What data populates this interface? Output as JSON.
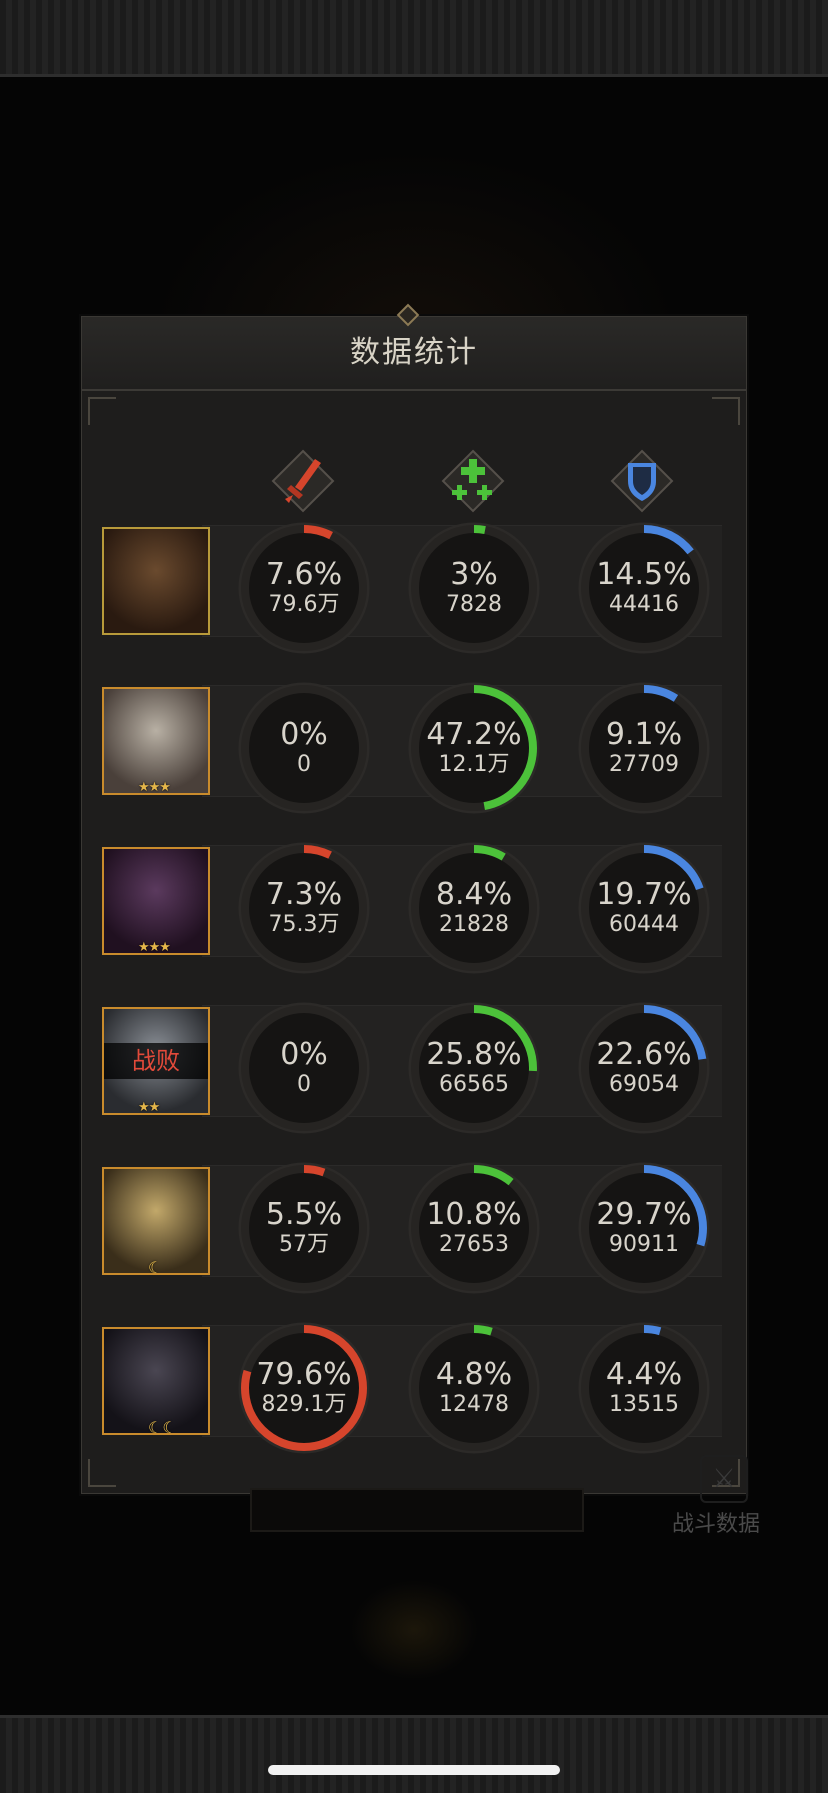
{
  "title": "数据统计",
  "background": {
    "corner_link_label": "战斗数据"
  },
  "columns": [
    {
      "name": "damage",
      "icon": "sword-icon",
      "color": "#d6452c"
    },
    {
      "name": "heal",
      "icon": "heal-cross-icon",
      "color": "#4cc23a"
    },
    {
      "name": "tank",
      "icon": "shield-icon",
      "color": "#4a86e0"
    }
  ],
  "heroes": [
    {
      "portrait": "bearded-warrior-portrait",
      "stars": "",
      "moons": "",
      "defeated": "",
      "stats": [
        {
          "pct": "7.6%",
          "value": "79.6万",
          "fraction": 0.076
        },
        {
          "pct": "3%",
          "value": "7828",
          "fraction": 0.03
        },
        {
          "pct": "14.5%",
          "value": "44416",
          "fraction": 0.145
        }
      ]
    },
    {
      "portrait": "silver-priestess-portrait",
      "stars": "★★★",
      "moons": "",
      "defeated": "",
      "stats": [
        {
          "pct": "0%",
          "value": "0",
          "fraction": 0
        },
        {
          "pct": "47.2%",
          "value": "12.1万",
          "fraction": 0.472
        },
        {
          "pct": "9.1%",
          "value": "27709",
          "fraction": 0.091
        }
      ]
    },
    {
      "portrait": "dark-mage-portrait",
      "stars": "★★★",
      "moons": "",
      "defeated": "",
      "stats": [
        {
          "pct": "7.3%",
          "value": "75.3万",
          "fraction": 0.073
        },
        {
          "pct": "8.4%",
          "value": "21828",
          "fraction": 0.084
        },
        {
          "pct": "19.7%",
          "value": "60444",
          "fraction": 0.197
        }
      ]
    },
    {
      "portrait": "winged-knight-portrait",
      "stars": "★★",
      "moons": "",
      "defeated": "战败",
      "stats": [
        {
          "pct": "0%",
          "value": "0",
          "fraction": 0
        },
        {
          "pct": "25.8%",
          "value": "66565",
          "fraction": 0.258
        },
        {
          "pct": "22.6%",
          "value": "69054",
          "fraction": 0.226
        }
      ]
    },
    {
      "portrait": "blonde-archer-portrait",
      "stars": "",
      "moons": "☾",
      "defeated": "",
      "stats": [
        {
          "pct": "5.5%",
          "value": "57万",
          "fraction": 0.055
        },
        {
          "pct": "10.8%",
          "value": "27653",
          "fraction": 0.108
        },
        {
          "pct": "29.7%",
          "value": "90911",
          "fraction": 0.297
        }
      ]
    },
    {
      "portrait": "dark-haired-rogue-portrait",
      "stars": "",
      "moons": "☾☾",
      "defeated": "",
      "stats": [
        {
          "pct": "79.6%",
          "value": "829.1万",
          "fraction": 0.796
        },
        {
          "pct": "4.8%",
          "value": "12478",
          "fraction": 0.048
        },
        {
          "pct": "4.4%",
          "value": "13515",
          "fraction": 0.044
        }
      ]
    }
  ]
}
